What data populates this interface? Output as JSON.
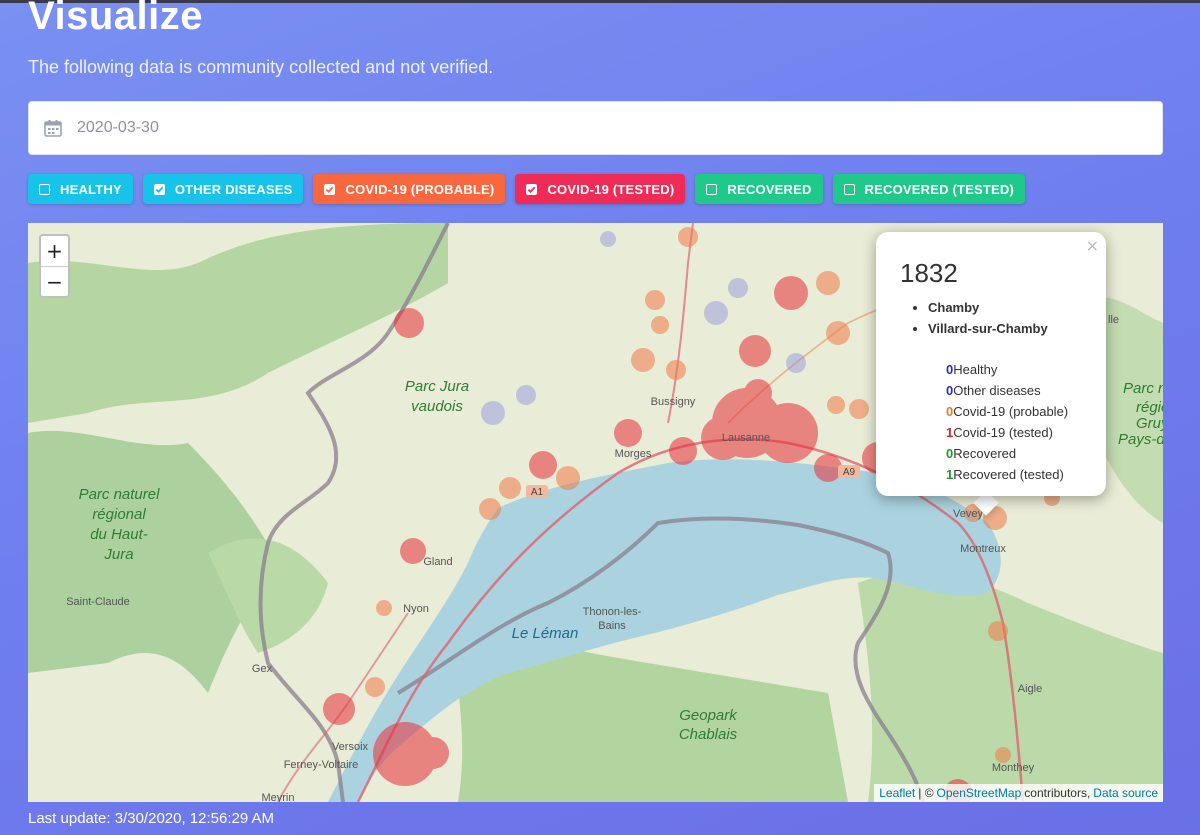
{
  "page": {
    "title": "Visualize",
    "subtitle": "The following data is community collected and not verified."
  },
  "date_filter": {
    "value": "2020-03-30",
    "icon": "calendar-icon"
  },
  "filters": [
    {
      "label": "HEALTHY",
      "checked": false,
      "color": "#17c3e8"
    },
    {
      "label": "OTHER DISEASES",
      "checked": true,
      "color": "#17c3e8"
    },
    {
      "label": "COVID-19 (PROBABLE)",
      "checked": true,
      "color": "#f9673f"
    },
    {
      "label": "COVID-19 (TESTED)",
      "checked": true,
      "color": "#ef2b57"
    },
    {
      "label": "RECOVERED",
      "checked": false,
      "color": "#1ec98a"
    },
    {
      "label": "RECOVERED (TESTED)",
      "checked": false,
      "color": "#1ec98a"
    }
  ],
  "map": {
    "zoom_in": "+",
    "zoom_out": "−",
    "colors": {
      "water": "#aad3df",
      "land": "#e9ecd6",
      "forest": "#add19e",
      "marker_red": "#e8303a",
      "marker_orange": "#f07a4a",
      "marker_purple": "#8f8fe0"
    },
    "labels": [
      "Parc Jura",
      "vaudois",
      "Parc naturel",
      "régional",
      "du Haut-",
      "Jura",
      "Bussigny",
      "Morges",
      "Lausanne",
      "A1",
      "A9",
      "Vevey",
      "Montreux",
      "Gland",
      "Nyon",
      "Saint-Claude",
      "Gex",
      "Versoix",
      "Ferney-Voltaire",
      "Meyrin",
      "Thonon-les-",
      "Bains",
      "Le Léman",
      "Geopark",
      "Chablais",
      "Aigle",
      "Monthey",
      "Parc n",
      "régiona",
      "Gruy",
      "Pays-d'",
      "lle"
    ],
    "attribution": {
      "leaflet": "Leaflet",
      "sep": "| ©",
      "osm": "OpenStreetMap",
      "contrib": "contributors,",
      "source": "Data source"
    }
  },
  "popup": {
    "title": "1832",
    "places": [
      "Chamby",
      "Villard-sur-Chamby"
    ],
    "counts": [
      {
        "value": "0",
        "label": "Healthy",
        "color": "#2a2ad0"
      },
      {
        "value": "0",
        "label": "Other diseases",
        "color": "#2a2ad0"
      },
      {
        "value": "0",
        "label": "Covid-19 (probable)",
        "color": "#f07a1a"
      },
      {
        "value": "1",
        "label": "Covid-19 (tested)",
        "color": "#e0202a"
      },
      {
        "value": "0",
        "label": "Recovered",
        "color": "#1a9a2a"
      },
      {
        "value": "1",
        "label": "Recovered (tested)",
        "color": "#1a9a2a"
      }
    ],
    "close": "×"
  },
  "footer": {
    "last_update": "Last update: 3/30/2020, 12:56:29 AM"
  }
}
